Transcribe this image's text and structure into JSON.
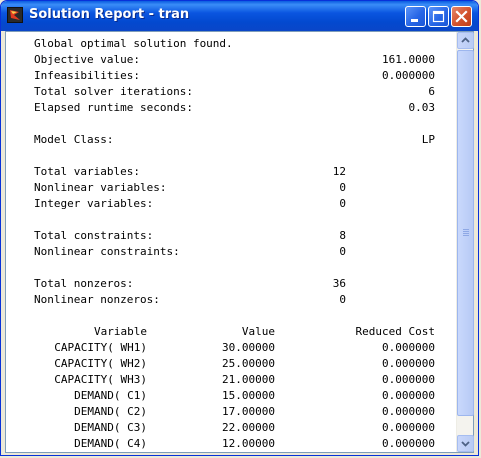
{
  "window": {
    "title": "Solution Report - tran",
    "icon": "lingo-app-icon",
    "controls": [
      "minimize-icon",
      "maximize-icon",
      "close-icon"
    ]
  },
  "report": {
    "status": "Global optimal solution found.",
    "summary": [
      {
        "label": "Objective value:",
        "value": "161.0000"
      },
      {
        "label": "Infeasibilities:",
        "value": "0.000000"
      },
      {
        "label": "Total solver iterations:",
        "value": "6"
      },
      {
        "label": "Elapsed runtime seconds:",
        "value": "0.03"
      }
    ],
    "model_class": {
      "label": "Model Class:",
      "value": "LP"
    },
    "variables": [
      {
        "label": "Total variables:",
        "value": "12"
      },
      {
        "label": "Nonlinear variables:",
        "value": "0"
      },
      {
        "label": "Integer variables:",
        "value": "0"
      }
    ],
    "constraints": [
      {
        "label": "Total constraints:",
        "value": "8"
      },
      {
        "label": "Nonlinear constraints:",
        "value": "0"
      }
    ],
    "nonzeros": [
      {
        "label": "Total nonzeros:",
        "value": "36"
      },
      {
        "label": "Nonlinear nonzeros:",
        "value": "0"
      }
    ],
    "table": {
      "headers": [
        "Variable",
        "Value",
        "Reduced Cost"
      ],
      "rows": [
        [
          "CAPACITY( WH1)",
          "30.00000",
          "0.000000"
        ],
        [
          "CAPACITY( WH2)",
          "25.00000",
          "0.000000"
        ],
        [
          "CAPACITY( WH3)",
          "21.00000",
          "0.000000"
        ],
        [
          "DEMAND( C1)",
          "15.00000",
          "0.000000"
        ],
        [
          "DEMAND( C2)",
          "17.00000",
          "0.000000"
        ],
        [
          "DEMAND( C3)",
          "22.00000",
          "0.000000"
        ],
        [
          "DEMAND( C4)",
          "12.00000",
          "0.000000"
        ]
      ]
    }
  },
  "scrollbar": {
    "up": "scroll-up-arrow-icon",
    "down": "scroll-down-arrow-icon"
  }
}
